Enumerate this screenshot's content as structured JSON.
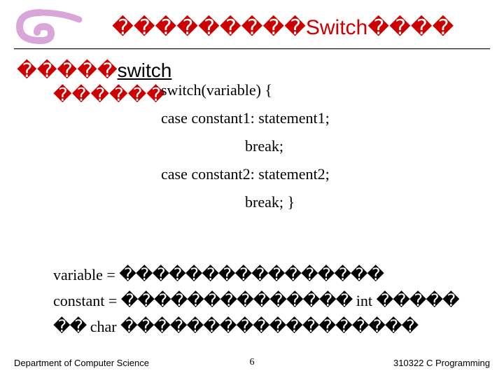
{
  "title": {
    "boxes": "���������",
    "word": "Switch",
    "boxes2": "����"
  },
  "sub1": {
    "boxes": "�����",
    "word": "switch"
  },
  "sub2": {
    "boxes": "������"
  },
  "code": {
    "l1": "switch(variable) {",
    "l2": "case constant1: statement1;",
    "l3": "break;",
    "l4": "case constant2: statement2;",
    "l5": "break; }"
  },
  "notes": {
    "var_label": "variable = ",
    "var_boxes": "����������������",
    "const_label": "constant = ",
    "const_boxes": "��������������",
    "int_word": " int ",
    "const_boxes2": "�����",
    "tail_boxes": "��",
    "char_word": " char ",
    "tail_boxes2": "������������������"
  },
  "footer": {
    "left": "Department of Computer Science",
    "mid": "6",
    "right": "310322 C Programming"
  },
  "logo_color": "#d9a6d9"
}
